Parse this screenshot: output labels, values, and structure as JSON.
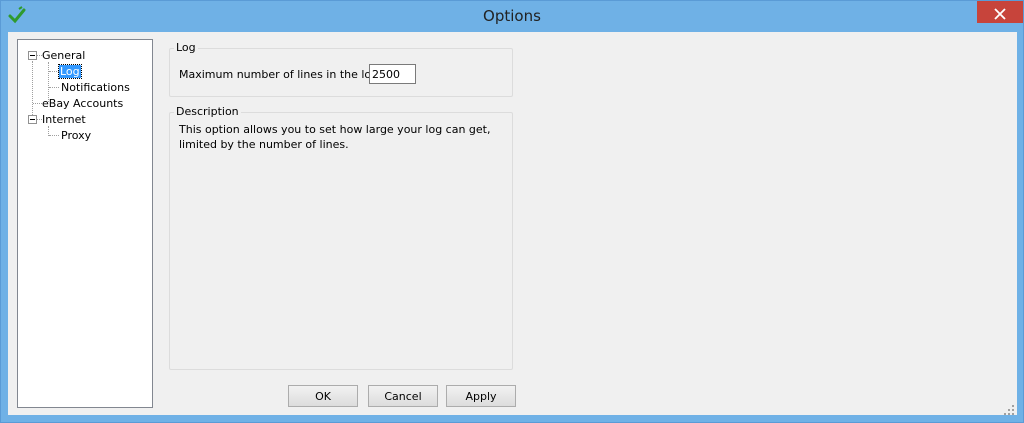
{
  "window": {
    "title": "Options"
  },
  "tree": {
    "items": [
      {
        "label": "General"
      },
      {
        "label": "Log"
      },
      {
        "label": "Notifications"
      },
      {
        "label": "eBay Accounts"
      },
      {
        "label": "Internet"
      },
      {
        "label": "Proxy"
      }
    ]
  },
  "log_group": {
    "title": "Log",
    "max_lines_label": "Maximum number of lines in the log:",
    "max_lines_value": "2500"
  },
  "description": {
    "title": "Description",
    "text": "This option allows you to set how large your log can get, limited by the number of lines."
  },
  "buttons": {
    "ok": "OK",
    "cancel": "Cancel",
    "apply": "Apply"
  },
  "colors": {
    "titlebar": "#6fb1e6",
    "close": "#c7443b",
    "selection": "#3399ff"
  },
  "icons": {
    "app": "green-check-icon",
    "close": "close-icon"
  }
}
